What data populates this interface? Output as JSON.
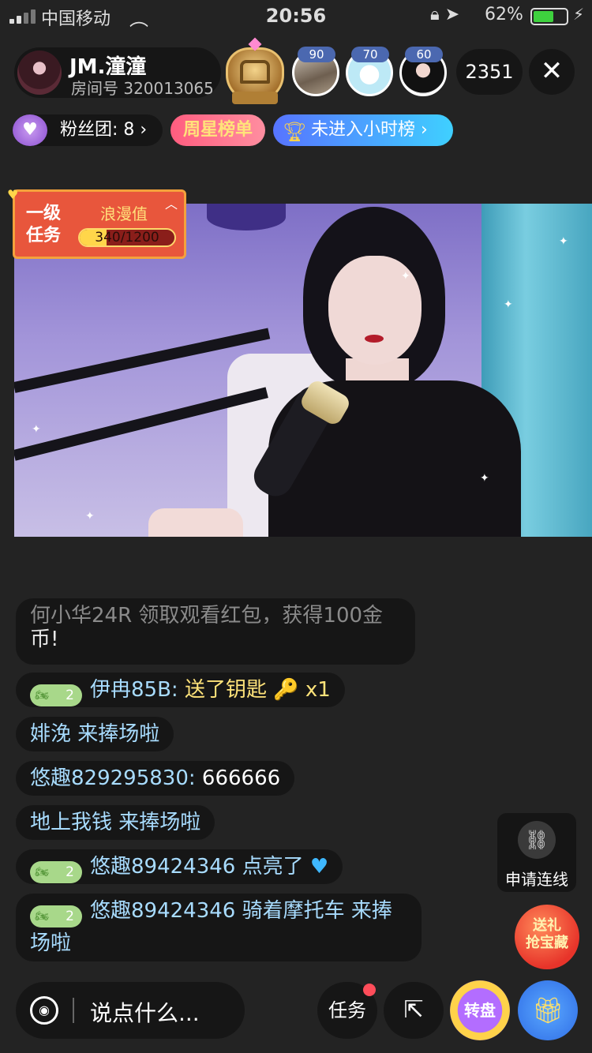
{
  "status_bar": {
    "carrier": "中国移动",
    "time": "20:56",
    "battery_pct": "62%",
    "battery_level": 0.62,
    "icons": [
      "signal-icon",
      "wifi-icon",
      "orientation-lock-icon",
      "location-icon",
      "battery-icon",
      "charging-icon"
    ]
  },
  "host": {
    "name": "JM.潼潼",
    "room": "房间号 320013065"
  },
  "viewers": {
    "levels": [
      "90",
      "70",
      "60"
    ],
    "count": "2351"
  },
  "close_icon": "✕",
  "badges": {
    "fans_club": "粉丝团: 8 ›",
    "week_star": "周星榜单",
    "hour_rank": "未进入小时榜 ›"
  },
  "mission": {
    "level": "一级任务",
    "romance": "浪漫值",
    "progress_text": "340/1200",
    "progress": 0.283
  },
  "chat": {
    "m0_faded": "何小华24R 领取观看红包，获得100金",
    "m0_tail": "币!",
    "m1_level": "2",
    "m1_user": "伊冉85B:",
    "m1_action": "送了钥匙",
    "m1_gift": "🔑 x1",
    "m2_text": "婔浼 来捧场啦",
    "m3_user": "悠趣829295830:",
    "m3_text": " 666666",
    "m4_text": "地上我钱 来捧场啦",
    "m5_level": "2",
    "m5_user": "悠趣89424346",
    "m5_text": " 点亮了 ",
    "m5_heart": "♥",
    "m6_level": "2",
    "m6_user": "悠趣89424346",
    "m6_text": " 骑着摩托车 来捧场啦"
  },
  "controls": {
    "link_request": "申请连线",
    "treasure_line1": "送礼",
    "treasure_line2": "抢宝藏",
    "input_placeholder": "说点什么...",
    "task": "任务",
    "wheel": "转盘"
  },
  "colors": {
    "accent_user": "#a8dcff",
    "gift": "#ffe37a",
    "mission": "#e8563c"
  }
}
